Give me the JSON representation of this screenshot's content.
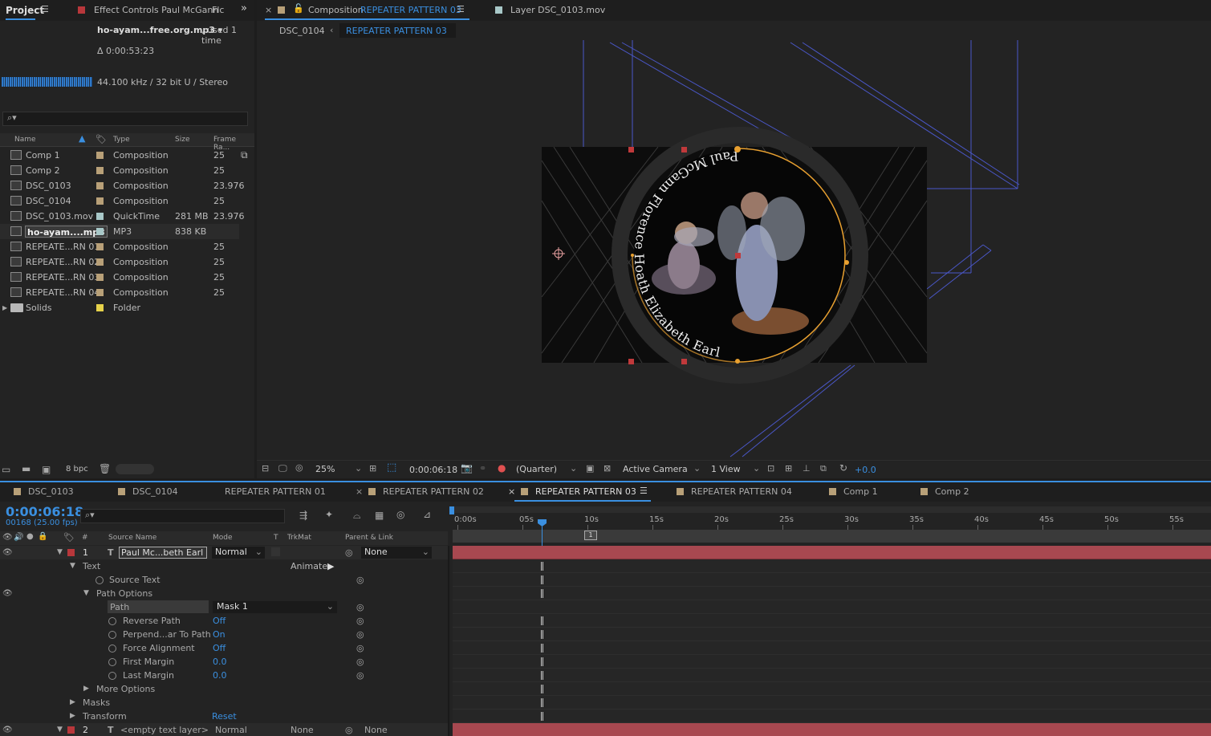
{
  "project": {
    "tab": "Project",
    "effect_tab": "Effect Controls Paul McGann",
    "effect_tab_suffix": "Flc",
    "file_name": "ho-ayam...free.org.mp3 ▾",
    "used_text": ", used 1 time",
    "duration": "Δ 0:00:53:23",
    "audio_info": "44.100 kHz / 32 bit U / Stereo",
    "columns": {
      "name": "Name",
      "type": "Type",
      "size": "Size",
      "frame_rate": "Frame Ra..."
    },
    "items": [
      {
        "name": "Comp 1",
        "type": "Composition",
        "size": "",
        "rate": "25",
        "color": "#b8a078",
        "icon": "composition-icon"
      },
      {
        "name": "Comp 2",
        "type": "Composition",
        "size": "",
        "rate": "25",
        "color": "#b8a078",
        "icon": "composition-icon"
      },
      {
        "name": "DSC_0103",
        "type": "Composition",
        "size": "",
        "rate": "23.976",
        "color": "#b8a078",
        "icon": "composition-icon"
      },
      {
        "name": "DSC_0104",
        "type": "Composition",
        "size": "",
        "rate": "25",
        "color": "#b8a078",
        "icon": "composition-icon"
      },
      {
        "name": "DSC_0103.mov",
        "type": "QuickTime",
        "size": "281 MB",
        "rate": "23.976",
        "color": "#a8c8c8",
        "icon": "footage-icon"
      },
      {
        "name": "ho-ayam....mp3",
        "type": "MP3",
        "size": "838 KB",
        "rate": "",
        "color": "#a8c8c8",
        "icon": "audio-file-icon"
      },
      {
        "name": "REPEATE...RN 01",
        "type": "Composition",
        "size": "",
        "rate": "25",
        "color": "#b8a078",
        "icon": "composition-icon"
      },
      {
        "name": "REPEATE...RN 02",
        "type": "Composition",
        "size": "",
        "rate": "25",
        "color": "#b8a078",
        "icon": "composition-icon"
      },
      {
        "name": "REPEATE...RN 03",
        "type": "Composition",
        "size": "",
        "rate": "25",
        "color": "#b8a078",
        "icon": "composition-icon"
      },
      {
        "name": "REPEATE...RN 04",
        "type": "Composition",
        "size": "",
        "rate": "25",
        "color": "#b8a078",
        "icon": "composition-icon"
      },
      {
        "name": "Solids",
        "type": "Folder",
        "size": "",
        "rate": "",
        "color": "#e6d24a",
        "icon": "folder-icon"
      }
    ],
    "bpc": "8 bpc"
  },
  "comp": {
    "tab_prefix": "Composition",
    "tab_name": "REPEATER PATTERN 03",
    "layer_tab": "Layer DSC_0103.mov",
    "breadcrumb_parent": "DSC_0104",
    "breadcrumb_current": "REPEATER PATTERN 03",
    "path_text": "Paul McGann  Florence Hoath  Elizabeth Earl",
    "zoom": "25%",
    "timecode": "0:00:06:18",
    "resolution": "(Quarter)",
    "camera": "Active Camera",
    "views": "1 View",
    "exposure": "+0.0"
  },
  "timeline": {
    "tabs": [
      "DSC_0103",
      "DSC_0104",
      "REPEATER PATTERN 01",
      "REPEATER PATTERN 02",
      "REPEATER PATTERN 03",
      "REPEATER PATTERN 04",
      "Comp 1",
      "Comp 2"
    ],
    "active_tab": "REPEATER PATTERN 03",
    "timecode": "0:00:06:18",
    "frames": "00168 (25.00 fps)",
    "columns": {
      "num": "#",
      "source": "Source Name",
      "mode": "Mode",
      "t": "T",
      "trkmat": "TrkMat",
      "parent": "Parent & Link"
    },
    "ruler": [
      "0:00s",
      "05s",
      "10s",
      "15s",
      "20s",
      "25s",
      "30s",
      "35s",
      "40s",
      "45s",
      "50s",
      "55s"
    ],
    "marker": "1",
    "layer1": {
      "num": "1",
      "name": "Paul Mc...beth Earl",
      "mode": "Normal",
      "parent": "None"
    },
    "props": {
      "text": "Text",
      "animate": "Animate:",
      "source_text": "Source Text",
      "path_options": "Path Options",
      "path": "Path",
      "path_value": "Mask 1",
      "reverse": "Reverse Path",
      "reverse_v": "Off",
      "perp": "Perpend...ar To Path",
      "perp_v": "On",
      "force": "Force Alignment",
      "force_v": "Off",
      "first": "First Margin",
      "first_v": "0.0",
      "last": "Last Margin",
      "last_v": "0.0",
      "more": "More Options",
      "masks": "Masks",
      "transform": "Transform",
      "reset": "Reset"
    },
    "layer2": {
      "num": "2",
      "name": "<empty text layer>",
      "mode": "Normal",
      "trkmat": "None",
      "parent": "None"
    }
  },
  "colors": {
    "accent": "#3a8fe0",
    "label_red": "#b8373b",
    "track_red": "#a84850",
    "mask_orange": "#e8a030"
  }
}
